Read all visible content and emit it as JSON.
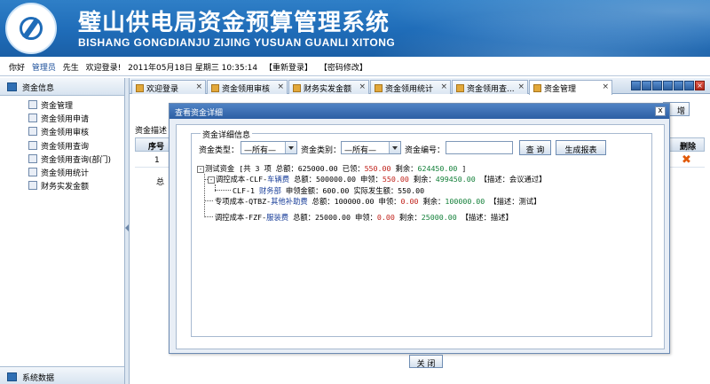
{
  "header": {
    "title": "璧山供电局资金预算管理系统",
    "subtitle": "BISHANG GONGDIANJU ZIJING YUSUAN GUANLI XITONG"
  },
  "userbar": {
    "greeting": "你好",
    "role": "管理员",
    "honorific": "先生",
    "welcome": "欢迎登录!",
    "datetime": "2011年05月18日  星期三  10:35:14",
    "relogin": "【重新登录】",
    "change_password": "【密码修改】"
  },
  "sidebar": {
    "section_title": "资金信息",
    "items": [
      {
        "label": "资金管理"
      },
      {
        "label": "资金领用申请"
      },
      {
        "label": "资金领用审核"
      },
      {
        "label": "资金领用查询"
      },
      {
        "label": "资金领用查询(部门)"
      },
      {
        "label": "资金领用统计"
      },
      {
        "label": "财务实发金额"
      }
    ],
    "footer_title": "系统数据"
  },
  "tabs": [
    {
      "label": "欢迎登录"
    },
    {
      "label": "资金领用审核"
    },
    {
      "label": "财务实发金额"
    },
    {
      "label": "资金领用统计"
    },
    {
      "label": "资金领用查..."
    },
    {
      "label": "资金管理"
    }
  ],
  "background": {
    "add_button": "增",
    "desc_label": "资金描述",
    "col_no": "序号",
    "col_delete": "删除",
    "row_no": "1",
    "total_label": "总"
  },
  "modal": {
    "title": "查看资金详细",
    "close_x": "x",
    "legend": "资金详细信息",
    "filters": {
      "type_label": "资金类型：",
      "type_value": "—所有—",
      "category_label": "资金类别：",
      "category_value": "—所有—",
      "code_label": "资金编号：",
      "code_value": "",
      "query_button": "查 询",
      "report_button": "生成报表"
    },
    "tree": {
      "root": {
        "toggle": "-",
        "name": "测试资金",
        "count_text": "[共 3 项",
        "total_label": "总额：",
        "total": "625000.00",
        "claimed_label": "已领：",
        "claimed": "550.00",
        "remain_label": "剩余：",
        "remain": "624450.00",
        "close_bracket": "]"
      },
      "items": [
        {
          "toggle": "-",
          "name_prefix": "调控成本-CLF-",
          "name": "车辆费",
          "total_label": "总额：",
          "total": "500000.00",
          "claim_label": "申领：",
          "claim": "550.00",
          "remain_label": "剩余：",
          "remain": "499450.00",
          "desc_label": "【描述：",
          "desc": "会议通过】"
        },
        {
          "name_prefix": "专项成本-QTBZ-",
          "name": "其他补助费",
          "total_label": "总额：",
          "total": "100000.00",
          "claim_label": "申领：",
          "claim": "0.00",
          "remain_label": "剩余：",
          "remain": "100000.00",
          "desc_label": "【描述：",
          "desc": "测试】"
        },
        {
          "name_prefix": "调控成本-FZF-",
          "name": "服装费",
          "total_label": "总额：",
          "total": "25000.00",
          "claim_label": "申领：",
          "claim": "0.00",
          "remain_label": "剩余：",
          "remain": "25000.00",
          "desc_label": "【描述：",
          "desc": "描述】"
        }
      ],
      "sub": {
        "code": "CLF-1",
        "dept": "财务部",
        "apply_label": "申领金额：",
        "apply": "600.00",
        "actual_label": "实际发生额：",
        "actual": "550.00"
      }
    },
    "close_button": "关 闭"
  },
  "colors": {
    "banner": "#1f6cb8",
    "red_value": "#c0211a",
    "green_value": "#14803a",
    "blue_value": "#1a3f9a"
  }
}
